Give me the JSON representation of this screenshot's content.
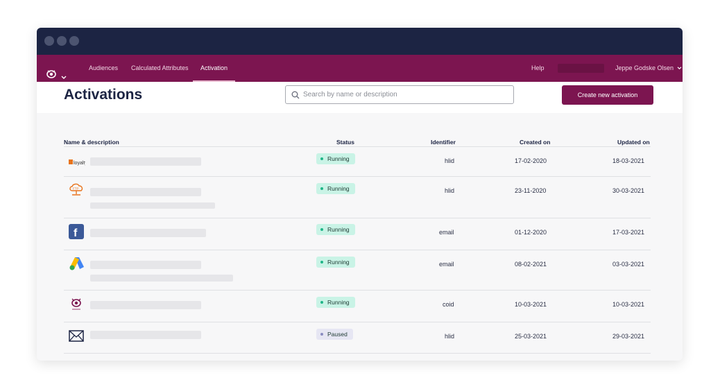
{
  "nav": {
    "items": [
      "Audiences",
      "Calculated Attributes",
      "Activation"
    ],
    "help": "Help",
    "user": "Jeppe Godske Olsen"
  },
  "page": {
    "title": "Activations",
    "search_placeholder": "Search by name or description",
    "create_label": "Create new activation"
  },
  "table": {
    "columns": [
      "Name & description",
      "Status",
      "Identifier",
      "Created on",
      "Updated on"
    ],
    "rows": [
      {
        "icon": "loyalty-logo-icon",
        "logo_text": "loyalty",
        "status": "Running",
        "identifier": "hlid",
        "created": "17-02-2020",
        "updated": "18-03-2021"
      },
      {
        "icon": "ftp-cloud-icon",
        "logo_text": "FTP",
        "status": "Running",
        "identifier": "hlid",
        "created": "23-11-2020",
        "updated": "30-03-2021"
      },
      {
        "icon": "facebook-icon",
        "logo_text": "f",
        "status": "Running",
        "identifier": "email",
        "created": "01-12-2020",
        "updated": "17-03-2021"
      },
      {
        "icon": "google-ads-icon",
        "status": "Running",
        "identifier": "email",
        "created": "08-02-2021",
        "updated": "03-03-2021"
      },
      {
        "icon": "brand-eye-icon",
        "status": "Running",
        "identifier": "coid",
        "created": "10-03-2021",
        "updated": "10-03-2021"
      },
      {
        "icon": "email-envelope-icon",
        "status": "Paused",
        "identifier": "hlid",
        "created": "25-03-2021",
        "updated": "29-03-2021"
      }
    ]
  },
  "colors": {
    "titlebar": "#1c2443",
    "navbar": "#7c1550",
    "accent": "#7c1550",
    "running_badge": "#c9f3e6",
    "paused_badge": "#e6e6f3"
  }
}
